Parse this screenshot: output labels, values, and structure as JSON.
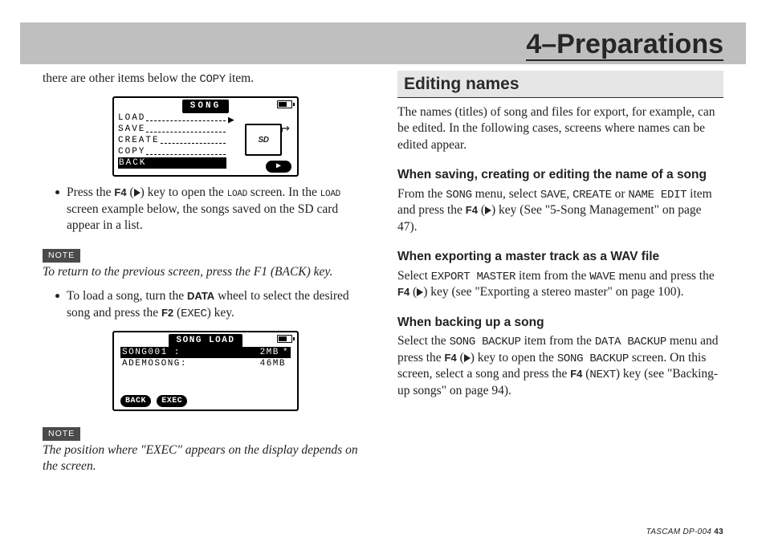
{
  "chapter": "4–Preparations",
  "left": {
    "intro_pre": "there are other items below the ",
    "intro_code": "COPY",
    "intro_post": " item.",
    "lcd1": {
      "title": "SONG",
      "items": [
        "LOAD",
        "SAVE",
        "CREATE",
        "COPY",
        "BACK"
      ],
      "selected": 4,
      "sd_label": "SD",
      "footer_play": "▶"
    },
    "bullet1_a": "Press the ",
    "bullet1_key": "F4",
    "bullet1_b": " (",
    "bullet1_c": ") key to open the ",
    "bullet1_code1": "LOAD",
    "bullet1_d": " screen. In the ",
    "bullet1_code2": "LOAD",
    "bullet1_e": " screen example below, the songs saved on the SD card appear in a list.",
    "note1_label": "NOTE",
    "note1_body": "To return to the previous screen, press the F1 (BACK) key.",
    "bullet2_a": "To load a song, turn the ",
    "bullet2_key": "DATA",
    "bullet2_b": " wheel to select the desired song and press the ",
    "bullet2_key2": "F2",
    "bullet2_c": " (",
    "bullet2_code": "EXEC",
    "bullet2_d": ") key.",
    "lcd2": {
      "title": "SONG LOAD",
      "rows": [
        {
          "name": "SONG001 :",
          "size": "2MB",
          "star": "*"
        },
        {
          "name": "ADEMOSONG:",
          "size": "46MB",
          "star": ""
        }
      ],
      "selected": 0,
      "footer": [
        "BACK",
        "EXEC"
      ]
    },
    "note2_label": "NOTE",
    "note2_body": "The position where \"EXEC\" appears on the display depends on the screen."
  },
  "right": {
    "section": "Editing names",
    "intro": "The names (titles) of song and files for export, for example, can be edited. In the following cases, screens where names can be edited appear.",
    "sub1": "When saving, creating or editing the name of a song",
    "p1_a": "From the ",
    "p1_code1": "SONG",
    "p1_b": " menu, select ",
    "p1_code2": "SAVE",
    "p1_c": ", ",
    "p1_code3": "CREATE",
    "p1_d": " or ",
    "p1_code4": "NAME EDIT",
    "p1_e": " item and press the ",
    "p1_key": "F4",
    "p1_f": " (",
    "p1_g": ") key (See \"5-Song Management\" on page 47).",
    "sub2": "When exporting a master track as a WAV file",
    "p2_a": "Select ",
    "p2_code1": "EXPORT MASTER",
    "p2_b": " item from the ",
    "p2_code2": "WAVE",
    "p2_c": " menu and press the ",
    "p2_key": "F4",
    "p2_d": " (",
    "p2_e": ") key (see \"Exporting a stereo master\" on page 100).",
    "sub3": "When backing up a song",
    "p3_a": "Select the ",
    "p3_code1": "SONG BACKUP",
    "p3_b": " item from the ",
    "p3_code2": "DATA BACKUP",
    "p3_c": " menu and press the ",
    "p3_key": "F4",
    "p3_d": " (",
    "p3_e": ") key to open the ",
    "p3_code3": "SONG BACKUP",
    "p3_f": " screen. On this screen, select a song and press the ",
    "p3_key2": "F4",
    "p3_g": " (",
    "p3_code4": "NEXT",
    "p3_h": ") key (see \"Backing-up songs\" on page 94)."
  },
  "footer": {
    "product": "TASCAM  DP-004",
    "page": "43"
  }
}
